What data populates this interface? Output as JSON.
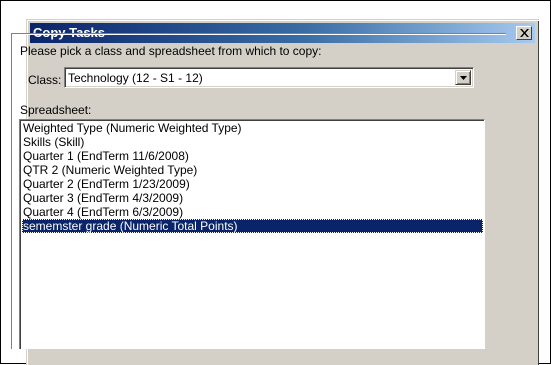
{
  "dialog": {
    "title": "Copy Tasks",
    "prompt": "Please pick a class and spreadsheet from which to copy:",
    "class_label": "Class:",
    "class_value": "Technology (12 - S1 - 12)",
    "spreadsheet_label": "Spreadsheet:",
    "spreadsheets": [
      "Weighted Type (Numeric Weighted Type)",
      "Skills (Skill)",
      "Quarter 1 (EndTerm 11/6/2008)",
      "QTR 2 (Numeric Weighted Type)",
      "Quarter 2 (EndTerm 1/23/2009)",
      "Quarter 3 (EndTerm 4/3/2009)",
      "Quarter 4 (EndTerm 6/3/2009)",
      "sememster grade (Numeric Total Points)"
    ],
    "selected_index": 7
  },
  "icons": {
    "close": "close-icon",
    "dropdown": "chevron-down-icon"
  },
  "colors": {
    "title_start": "#0a246a",
    "title_end": "#a6caf0",
    "selection": "#0a246a",
    "face": "#d4d0c8"
  }
}
